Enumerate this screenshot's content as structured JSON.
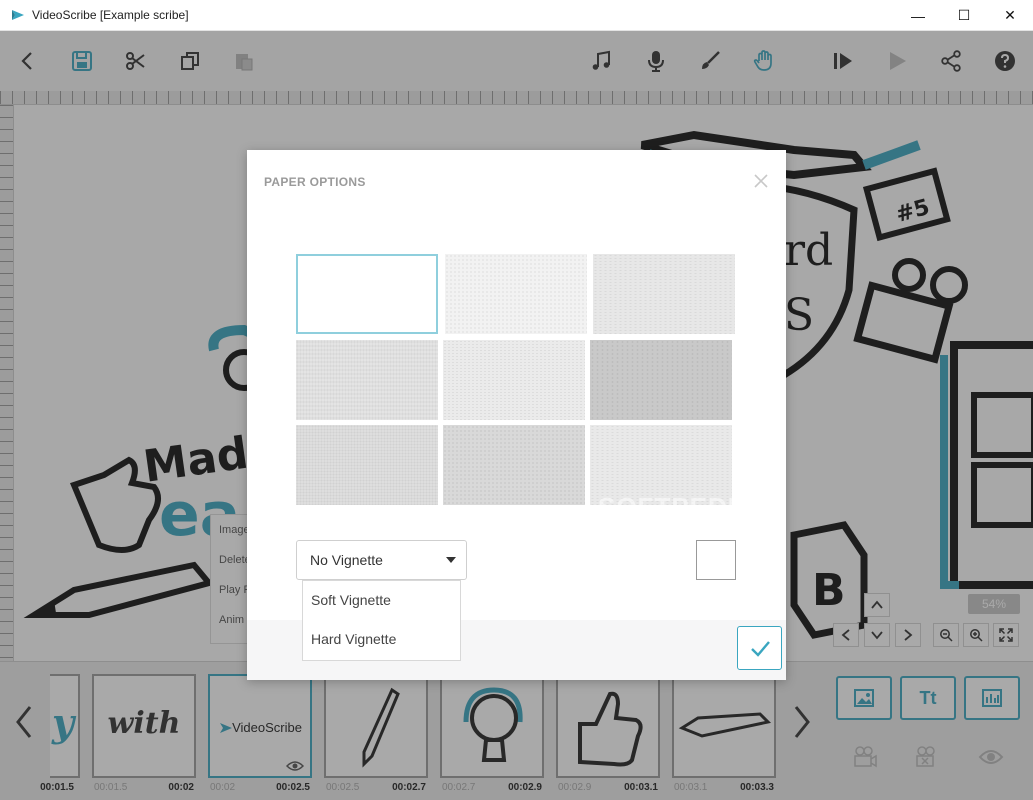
{
  "window": {
    "title": "VideoScribe [Example scribe]",
    "minimize_glyph": "—",
    "maximize_glyph": "☐",
    "close_glyph": "✕"
  },
  "toolbar": {
    "left_icons": [
      "back-icon",
      "save-icon",
      "cut-icon",
      "copy-icon",
      "paste-icon"
    ],
    "right_icons": [
      "music-icon",
      "microphone-icon",
      "brush-icon",
      "hand-icon",
      "preview-icon",
      "play-icon",
      "share-icon",
      "help-icon"
    ],
    "accent": "#3aa6c0"
  },
  "canvas": {
    "context_menu": [
      "Image",
      "Delete",
      "Play F",
      "Anim"
    ],
    "zoom_level": "54%"
  },
  "dialog": {
    "title": "PAPER OPTIONS",
    "papers": [
      {
        "name": "white",
        "color": "#ffffff"
      },
      {
        "name": "paper-2",
        "color": "#f2f2f2"
      },
      {
        "name": "paper-3",
        "color": "#e7e7e7"
      },
      {
        "name": "paper-4",
        "color": "#e4e4e4"
      },
      {
        "name": "paper-5",
        "color": "#ebebeb"
      },
      {
        "name": "paper-6",
        "color": "#c9c9c9"
      },
      {
        "name": "paper-7",
        "color": "#dedede"
      },
      {
        "name": "paper-8",
        "color": "#d9d9d9"
      },
      {
        "name": "paper-9",
        "color": "#e9e9e9"
      }
    ],
    "selected_paper": 0,
    "vignette": {
      "selected": "No Vignette",
      "options": [
        "Soft Vignette",
        "Hard Vignette"
      ]
    },
    "background_color": "#ffffff"
  },
  "timeline": {
    "thumbnails": [
      {
        "label": "y",
        "start": "",
        "end": "00:01.5",
        "style": "cyan"
      },
      {
        "label": "with",
        "start": "00:01.5",
        "end": "00:02",
        "style": "script"
      },
      {
        "label": "VideoScribe",
        "start": "00:02",
        "end": "00:02.5",
        "style": "vs",
        "selected": true
      },
      {
        "label": "",
        "start": "00:02.5",
        "end": "00:02.7",
        "style": "pencil"
      },
      {
        "label": "",
        "start": "00:02.7",
        "end": "00:02.9",
        "style": "bulb"
      },
      {
        "label": "",
        "start": "00:02.9",
        "end": "00:03.1",
        "style": "thumb"
      },
      {
        "label": "",
        "start": "00:03.1",
        "end": "00:03.3",
        "style": "pen"
      }
    ],
    "add_text_label": "Tt"
  },
  "watermark": "SOFTPEDIA"
}
